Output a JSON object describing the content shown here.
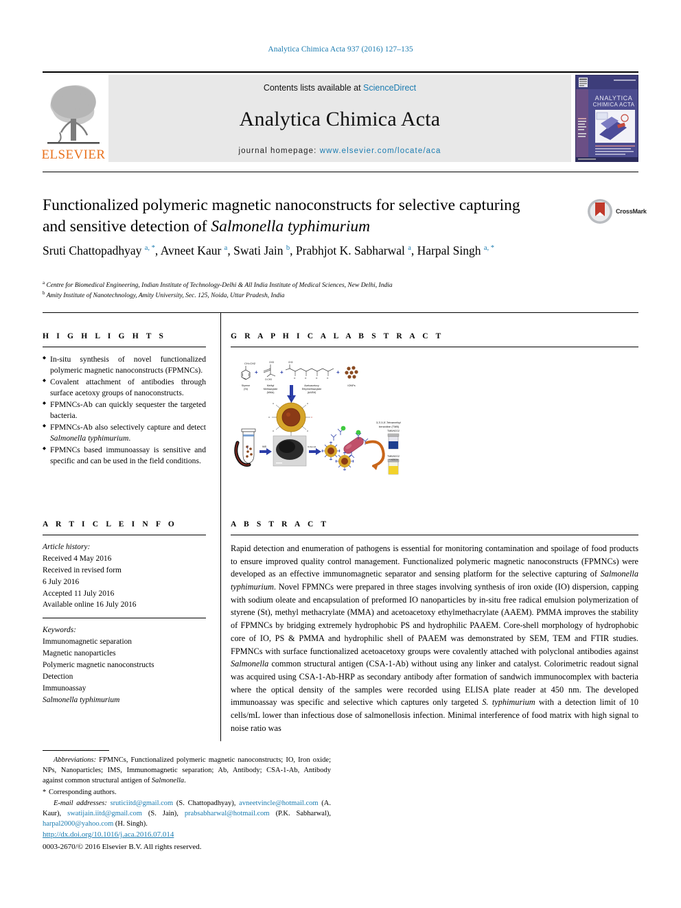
{
  "running_head": "Analytica Chimica Acta 937 (2016) 127–135",
  "masthead": {
    "publisher_logo_text": "ELSEVIER",
    "contents_prefix": "Contents lists available at ",
    "contents_link": "ScienceDirect",
    "journal_name": "Analytica Chimica Acta",
    "homepage_prefix": "journal homepage: ",
    "homepage_url": "www.elsevier.com/locate/aca",
    "cover_title_line1": "ANALYTICA",
    "cover_title_line2": "CHIMICA ACTA"
  },
  "article": {
    "title_part1": "Functionalized polymeric magnetic nanoconstructs for selective capturing and sensitive detection of ",
    "title_italic": "Salmonella typhimurium",
    "crossmark_label": "CrossMark",
    "authors_html": "Sruti Chattopadhyay <sup>a, *</sup>, Avneet Kaur <sup>a</sup>, Swati Jain <sup>b</sup>, Prabhjot K. Sabharwal <sup>a</sup>, Harpal Singh <sup>a, *</sup>",
    "affiliation_a": "Centre for Biomedical Engineering, Indian Institute of Technology-Delhi & All India Institute of Medical Sciences, New Delhi, India",
    "affiliation_b": "Amity Institute of Nanotechnology, Amity University, Sec. 125, Noida, Uttar Pradesh, India"
  },
  "highlights": {
    "heading": "H I G H L I G H T S",
    "items": [
      "In-situ synthesis of novel functionalized polymeric magnetic nanoconstructs (FPMNCs).",
      "Covalent attachment of antibodies through surface acetoxy groups of nanoconstructs.",
      "FPMNCs-Ab can quickly sequester the targeted bacteria.",
      "FPMNCs-Ab also selectively capture and detect Salmonella typhimurium.",
      "FPMNCs based immunoassay is sensitive and specific and can be used in the field conditions."
    ]
  },
  "graphical_abstract": {
    "heading": "G R A P H I C A L  A B S T R A C T",
    "figure_labels": {
      "styrene": "Styrene (St)",
      "mma": "Methyl Methacrylate (MMA)",
      "aaem": "Acetoacetoxy Ethylmethacrylate (AAEM)",
      "npa": "IONPs",
      "tmb_label": "3,3',5,5'-Tetramethyl benzidine (TMB)",
      "tmb_h2o2": "TMB/H₂O₂",
      "tmb_h2o2_stop": "TMB/H₂O₂",
      "ims": "IMS",
      "unbound": "Unbound"
    }
  },
  "article_info": {
    "heading": "A R T I C L E  I N F O",
    "history_label": "Article history:",
    "history": [
      "Received 4 May 2016",
      "Received in revised form",
      "6 July 2016",
      "Accepted 11 July 2016",
      "Available online 16 July 2016"
    ],
    "keywords_label": "Keywords:",
    "keywords": [
      "Immunomagnetic separation",
      "Magnetic nanoparticles",
      "Polymeric magnetic nanoconstructs",
      "Detection",
      "Immunoassay"
    ],
    "keyword_italic": "Salmonella typhimurium"
  },
  "abstract": {
    "heading": "A B S T R A C T",
    "paragraph_html": "Rapid detection and enumeration of pathogens is essential for monitoring contamination and spoilage of food products to ensure improved quality control management. Functionalized polymeric magnetic nanoconstructs (FPMNCs) were developed as an effective immunomagnetic separator and sensing platform for the selective capturing of <span class=\"it\">Salmonella typhimurium</span>. Novel FPMNCs were prepared in three stages involving synthesis of iron oxide (IO) dispersion, capping with sodium oleate and encapsulation of preformed IO nanoparticles by in-situ free radical emulsion polymerization of styrene (St), methyl methacrylate (MMA) and acetoacetoxy ethylmethacrylate (AAEM). PMMA improves the stability of FPMNCs by bridging extremely hydrophobic PS and hydrophilic PAAEM. Core-shell morphology of hydrophobic core of IO, PS &amp; PMMA and hydrophilic shell of PAAEM was demonstrated by SEM, TEM and FTIR studies. FPMNCs with surface functionalized acetoacetoxy groups were covalently attached with polyclonal antibodies against <span class=\"it\">Salmonella</span> common structural antigen (CSA-1-Ab) without using any linker and catalyst. Colorimetric readout signal was acquired using CSA-1-Ab-HRP as secondary antibody after formation of sandwich immunocomplex with bacteria where the optical density of the samples were recorded using ELISA plate reader at 450 nm. The developed immunoassay was specific and selective which captures only targeted <span class=\"it\">S. typhimurium</span> with a detection limit of 10 cells/mL lower than infectious dose of salmonellosis infection. Minimal interference of food matrix with high signal to noise ratio was"
  },
  "footnotes": {
    "abbreviations_html": "<span class=\"it\">Abbreviations:</span> FPMNCs, Functionalized polymeric magnetic nanoconstructs; IO, Iron oxide; NPs, Nanoparticles; IMS, Immunomagnetic separation; Ab, Antibody; CSA-1-Ab, Antibody against common structural antigen of <span class=\"it\">Salmonella</span>.",
    "corresponding": "Corresponding authors.",
    "email_label": "E-mail addresses:",
    "emails": [
      {
        "address": "sruticiitd@gmail.com",
        "name": "(S. Chattopadhyay)"
      },
      {
        "address": "avneetvincle@hotmail.com",
        "name": "(A. Kaur)"
      },
      {
        "address": "swatijain.iitd@gmail.com",
        "name": "(S. Jain)"
      },
      {
        "address": "prabsabharwal@hotmail.com",
        "name": "(P.K. Sabharwal)"
      },
      {
        "address": "harpal2000@yahoo.com",
        "name": "(H. Singh)"
      }
    ],
    "doi": "http://dx.doi.org/10.1016/j.aca.2016.07.014",
    "copyright": "0003-2670/© 2016 Elsevier B.V. All rights reserved."
  },
  "colors": {
    "link_blue": "#1a7bb0",
    "elsevier_orange": "#E9711C",
    "band_gray": "#e8e8e8"
  }
}
